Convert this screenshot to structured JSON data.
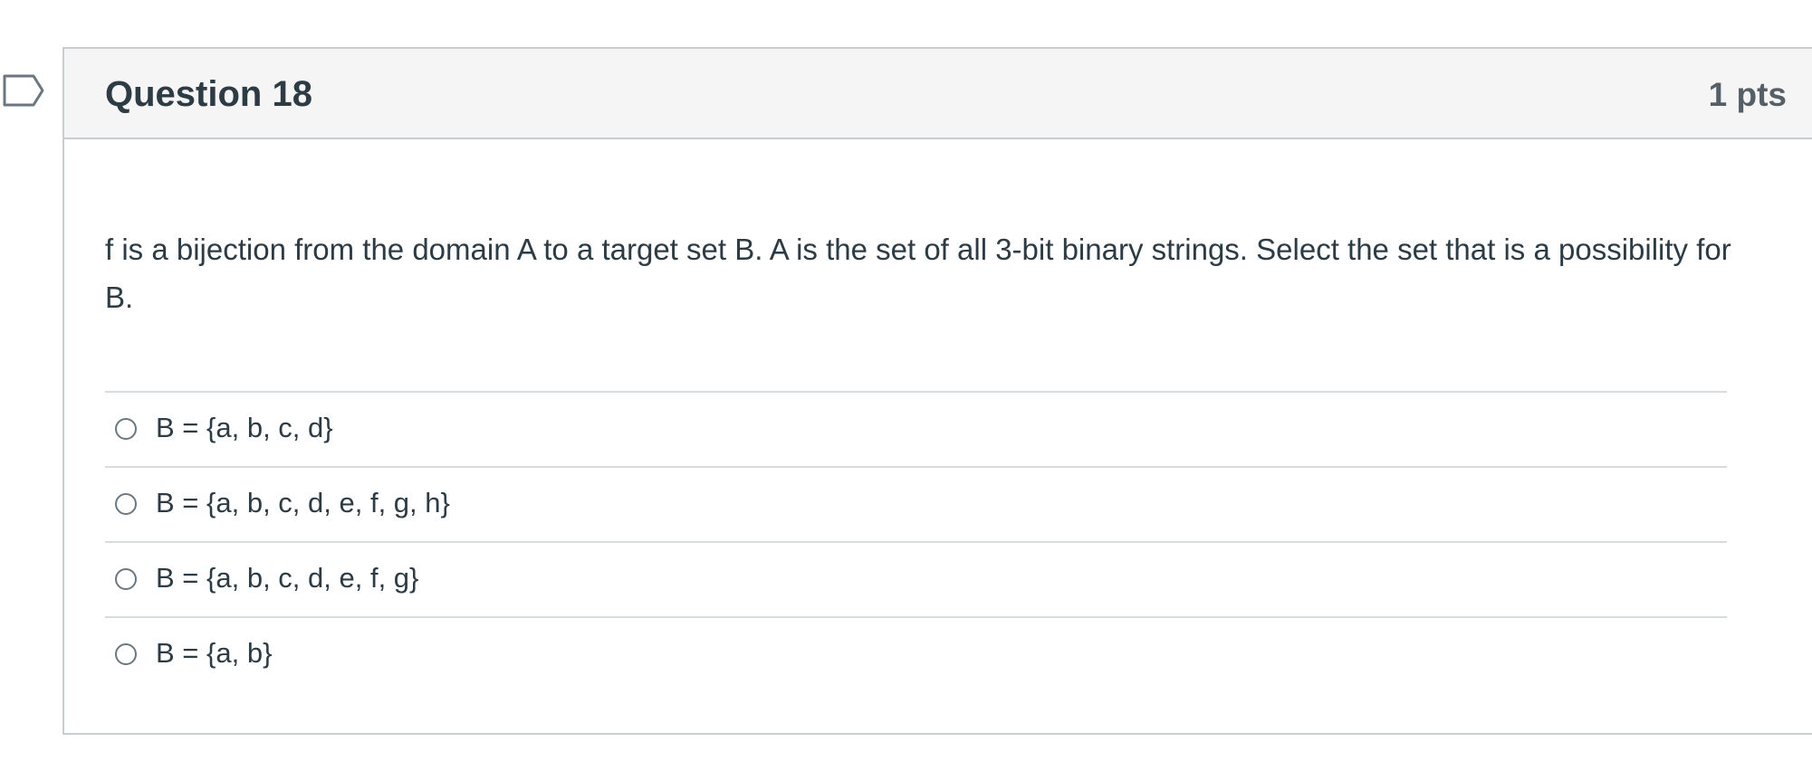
{
  "question": {
    "title": "Question 18",
    "points": "1 pts",
    "text": "f is a bijection from the domain A to a target set B. A is the set of all 3-bit binary strings. Select the set that is a possibility for B.",
    "flag_icon": "flag-icon"
  },
  "answers": [
    {
      "label": "B = {a, b, c, d}",
      "selected": false
    },
    {
      "label": "B = {a, b, c, d, e, f, g, h}",
      "selected": false
    },
    {
      "label": "B = {a, b, c, d, e, f, g}",
      "selected": false
    },
    {
      "label": "B = {a, b}",
      "selected": false
    }
  ],
  "colors": {
    "text": "#2d3b45",
    "header_bg": "#f5f5f5",
    "border": "#c7cdd1",
    "divider": "#d8dcde",
    "points_text": "#555f67"
  }
}
